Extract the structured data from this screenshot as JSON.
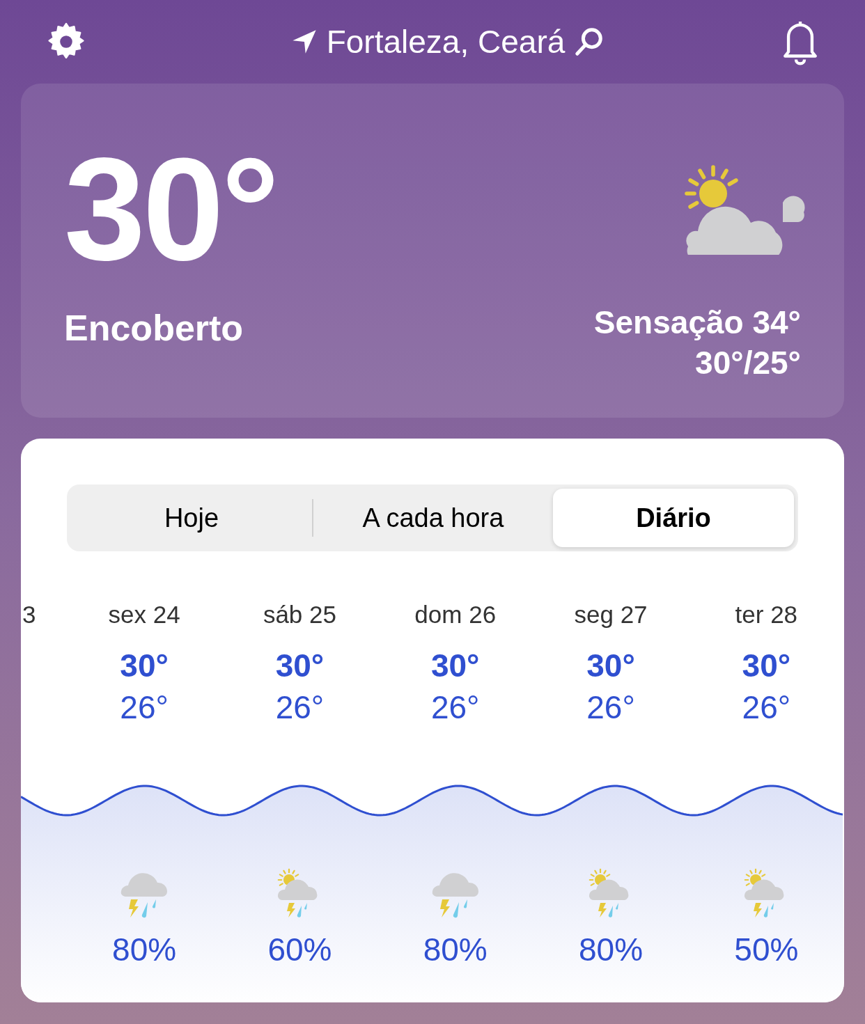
{
  "header": {
    "location": "Fortaleza, Ceará"
  },
  "current": {
    "temperature": "30°",
    "condition": "Encoberto",
    "feels_like": "Sensação 34°",
    "high_low": "30°/25°"
  },
  "tabs": [
    {
      "label": "Hoje",
      "selected": false
    },
    {
      "label": "A cada hora",
      "selected": false
    },
    {
      "label": "Diário",
      "selected": true
    }
  ],
  "partial_day": "3",
  "days": [
    {
      "day": "sex 24",
      "high": "30°",
      "low": "26°",
      "kind": "storm",
      "rain": "80%"
    },
    {
      "day": "sáb 25",
      "high": "30°",
      "low": "26°",
      "kind": "sun_storm",
      "rain": "60%"
    },
    {
      "day": "dom 26",
      "high": "30°",
      "low": "26°",
      "kind": "storm",
      "rain": "80%"
    },
    {
      "day": "seg 27",
      "high": "30°",
      "low": "26°",
      "kind": "sun_storm",
      "rain": "80%"
    },
    {
      "day": "ter 28",
      "high": "30°",
      "low": "26°",
      "kind": "sun_storm",
      "rain": "50%"
    }
  ]
}
